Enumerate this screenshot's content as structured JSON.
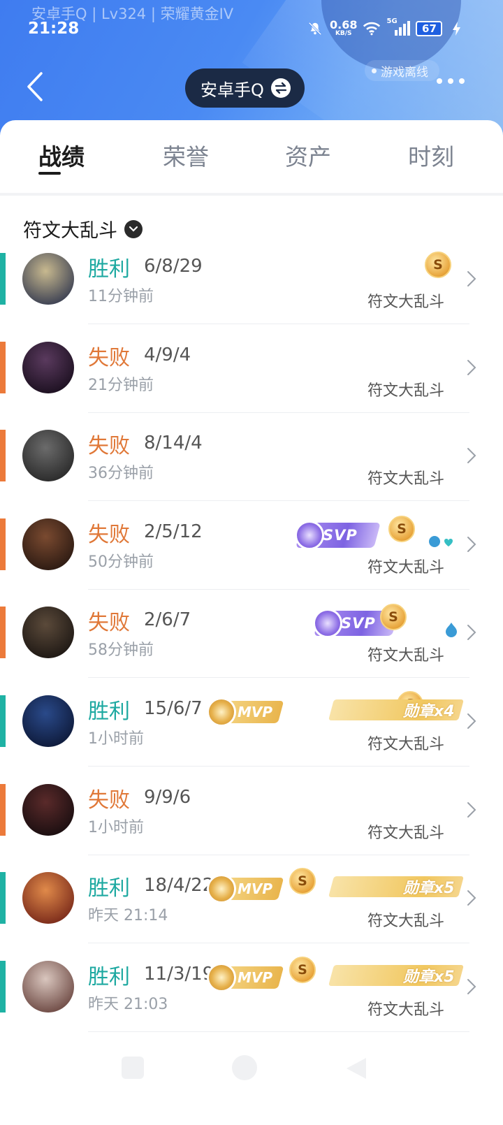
{
  "status_bar": {
    "profile_line": "安卓手Q | Lv324 | 荣耀黄金IV",
    "time": "21:28",
    "net_speed": "0.68",
    "net_unit": "KB/S",
    "signal_label": "5G",
    "battery": "67"
  },
  "header": {
    "offline_text": "游戏离线",
    "account_name": "安卓手Q"
  },
  "tabs": [
    "战绩",
    "荣誉",
    "资产",
    "时刻"
  ],
  "active_tab": 0,
  "filter": {
    "label": "符文大乱斗"
  },
  "colors": {
    "win": "#1ea9a1",
    "loss": "#e07838",
    "header": "#4a8af3"
  },
  "matches": [
    {
      "result": "胜利",
      "outcome": "win",
      "kda": "6/8/29",
      "ago": "11分钟前",
      "mode": "符文大乱斗",
      "badges": [
        "gold-coin"
      ]
    },
    {
      "result": "失败",
      "outcome": "loss",
      "kda": "4/9/4",
      "ago": "21分钟前",
      "mode": "符文大乱斗",
      "badges": []
    },
    {
      "result": "失败",
      "outcome": "loss",
      "kda": "8/14/4",
      "ago": "36分钟前",
      "mode": "符文大乱斗",
      "badges": []
    },
    {
      "result": "失败",
      "outcome": "loss",
      "kda": "2/5/12",
      "ago": "50分钟前",
      "mode": "符文大乱斗",
      "badges": [
        "svp",
        "gold-coin",
        "team-icons"
      ],
      "svp_label": "SVP"
    },
    {
      "result": "失败",
      "outcome": "loss",
      "kda": "2/6/7",
      "ago": "58分钟前",
      "mode": "符文大乱斗",
      "badges": [
        "svp",
        "gold-coin",
        "team-icon"
      ],
      "svp_label": "SVP"
    },
    {
      "result": "胜利",
      "outcome": "win",
      "kda": "15/6/7",
      "ago": "1小时前",
      "mode": "符文大乱斗",
      "badges": [
        "mvp",
        "gold-coin",
        "medal"
      ],
      "mvp_label": "MVP",
      "medal_label": "勋章x4"
    },
    {
      "result": "失败",
      "outcome": "loss",
      "kda": "9/9/6",
      "ago": "1小时前",
      "mode": "符文大乱斗",
      "badges": []
    },
    {
      "result": "胜利",
      "outcome": "win",
      "kda": "18/4/22",
      "ago": "昨天 21:14",
      "mode": "符文大乱斗",
      "badges": [
        "mvp",
        "gold-coin",
        "medal"
      ],
      "mvp_label": "MVP",
      "medal_label": "勋章x5"
    },
    {
      "result": "胜利",
      "outcome": "win",
      "kda": "11/3/19",
      "ago": "昨天 21:03",
      "mode": "符文大乱斗",
      "badges": [
        "mvp",
        "gold-coin",
        "medal"
      ],
      "mvp_label": "MVP",
      "medal_label": "勋章x5"
    }
  ],
  "coin_letter": "S"
}
